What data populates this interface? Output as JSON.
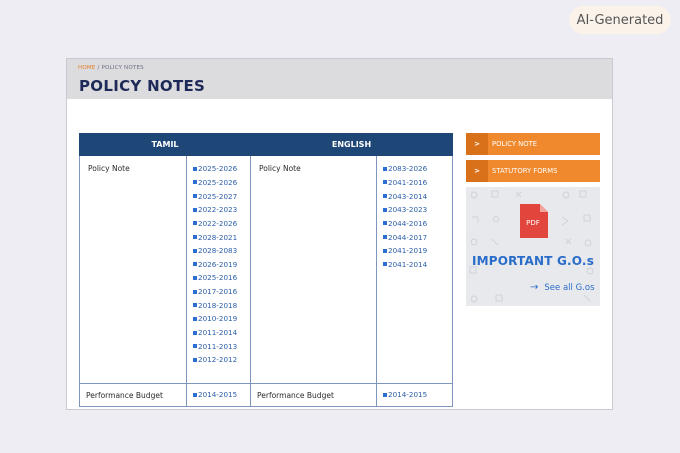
{
  "badge": "AI-Generated",
  "breadcrumb": {
    "home": "HOME",
    "separator": " / ",
    "current": "POLICY NOTES"
  },
  "page_title": "POLICY NOTES",
  "table": {
    "headers": [
      "TAMIL",
      "ENGLISH"
    ],
    "rows": [
      {
        "tamil_label": "Policy Note",
        "tamil_years": [
          "2025-2026",
          "2025-2026",
          "2025-2027",
          "2022-2023",
          "2022-2026",
          "2028-2021",
          "2028-2083",
          "2026-2019",
          "2025-2016",
          "2017-2016",
          "2018-2018",
          "2010-2019",
          "2011-2014",
          "2011-2013",
          "2012-2012"
        ],
        "english_label": "Policy Note",
        "english_years": [
          "2083-2026",
          "2041-2016",
          "2043-2014",
          "2043-2023",
          "2044-2016",
          "2044-2017",
          "2041-2019",
          "2041-2014"
        ]
      },
      {
        "tamil_label": "Performance Budget",
        "tamil_years": [
          "2014-2015"
        ],
        "english_label": "Performance Budget",
        "english_years": [
          "2014-2015"
        ]
      }
    ]
  },
  "sidebar": {
    "buttons": [
      {
        "chevron": ">",
        "label": "POLICY NOTE"
      },
      {
        "chevron": ">",
        "label": "STATUTORY FORMS"
      }
    ],
    "gos": {
      "pdf_label": "PDF",
      "title": "IMPORTANT G.O.s",
      "link": "See all G.os",
      "arrow": "→"
    }
  },
  "colors": {
    "header_bg": "#1e4676",
    "orange": "#f0892d",
    "link_blue": "#2c5fa8",
    "title_navy": "#1d2a57",
    "pdf_red": "#e2453c"
  }
}
